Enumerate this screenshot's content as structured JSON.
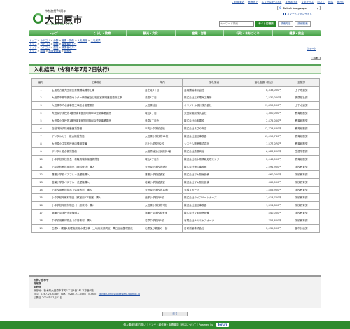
{
  "topbar": {
    "links": [
      "ご利用案内",
      "音声読上",
      "ふりがなをつける",
      "よみあげる",
      "文字サイズ",
      "小さく",
      "標準",
      "大きく"
    ]
  },
  "header": {
    "anniversary": "市制施行70周年",
    "city_name": "大田原市",
    "city_romaji": "OHTAWARA CITY",
    "lang_select": "Select Language",
    "phone_link": "スマートフォンサイト",
    "search_placeholder": "キーワード検索",
    "search_button": "サイト内検索",
    "howto_button": "検索方法",
    "advanced_button": "詳細検索"
  },
  "gnav": [
    "トップ",
    "くらし・教育",
    "観光・文化",
    "産業・労働",
    "行政・まちづくり",
    "健康・安全"
  ],
  "breadcrumbs": [
    [
      "トップ",
      "カテゴリ",
      "分野",
      "産業・労働",
      "入札情報",
      "入札結果"
    ],
    [
      "トップ",
      "カテゴリ",
      "組織",
      "事業者の方へ"
    ],
    [
      "トップ",
      "カテゴリ",
      "属性",
      "事業者の方へ"
    ],
    [
      "トップ",
      "組織",
      "検査管理課",
      "財務課"
    ]
  ],
  "tweet": "ツイート",
  "print": "印刷",
  "page_title": "入札結果（令和6年7月2日執行）",
  "table": {
    "headers": [
      "番号",
      "工事等名",
      "場所",
      "落札業者",
      "落札金額（税込）",
      "主管課"
    ],
    "rows": [
      [
        "1",
        "主要地方道大田原氏家線舗装補修工事",
        "富士見3丁目",
        "富岡舗装株式会社",
        "8,338,000円",
        "上下水道課"
      ],
      [
        "2",
        "大田原市職場健康センター研修室及び相談室照明器具更新工事",
        "浅香3丁目",
        "株式会社三和電気工業所",
        "2,530,000円",
        "健康福祉課"
      ],
      [
        "3",
        "大田原市内水道事業工事総合管理委託",
        "大田原地区",
        "オリジナル設計株式会社",
        "29,850,000円",
        "上下水道課"
      ],
      [
        "4",
        "大田原小学校外1箇所体育館照明等LED更新事業委託",
        "城山1丁目",
        "大田原電設株式会社",
        "3,300,000円",
        "教育総務課"
      ],
      [
        "5",
        "大田原小学校外1箇所体育館照明等LED更新事業委託",
        "美原1丁目外",
        "株式会社山本電設",
        "2,475,000円",
        "教育総務課"
      ],
      [
        "6",
        "自動体外式除細動器賃貸借",
        "市内小中学校全校",
        "株式会社まさや商店",
        "12,723,460円",
        "教育総務課"
      ],
      [
        "7",
        "デジタルカラー複合機賃貸借",
        "大田原小学校外11校",
        "株式会社渡辺事務器",
        "13,010,780円",
        "教育総務課"
      ],
      [
        "8",
        "大田原小中学校校地内情報整備",
        "石上小学校外2校",
        "システム興産株式会社",
        "1,577,070円",
        "教育総務課"
      ],
      [
        "9",
        "デジタル複合機賃貸借",
        "大田原地区公民館外4館",
        "株式会社斎藤商社",
        "6,988,600円",
        "生涯学習課"
      ],
      [
        "10",
        "小中学校学校校長・教職員端末機器賃貸借",
        "城山1丁目外",
        "株式会社栃木県情報処理センター",
        "2,046,000円",
        "教育総務課"
      ],
      [
        "11",
        "小中学校教材用物品（理科教材）購入",
        "大田原小学校外5校",
        "株式会社渡辺事務器",
        "2,591,900円",
        "学校教育課"
      ],
      [
        "12",
        "藩藩小学校バスフル－洗濯機購入",
        "藩藩小学校給食室",
        "株式会社マキ厨房設備",
        "660,000円",
        "学校教育課"
      ],
      [
        "13",
        "若葉小学校バスフル－洗濯機購入",
        "若葉小学校給食室",
        "株式会社マキ厨房設備",
        "660,000円",
        "学校教育課"
      ],
      [
        "14",
        "小学校用教材物品（体育教材）購入",
        "大田原小学校外10校",
        "大橋スポーツ",
        "1,406,900円",
        "学校教育課"
      ],
      [
        "15",
        "小中学校用教材物品（教室用ICT機器）購入",
        "西那小学校外6校",
        "株式会社ライフパートナーズ",
        "1,613,700円",
        "学校教育課"
      ],
      [
        "16",
        "小中学校用教材物品（一般教材）購入",
        "大田原小学校外7校",
        "株式会社渡辺事務器",
        "1,394,800円",
        "学校教育課"
      ],
      [
        "17",
        "湯津上中学校洗濯機購入",
        "湯津上中学校給食室",
        "株式会社マキ厨房設備",
        "440,000円",
        "学校教育課"
      ],
      [
        "18",
        "中学校用教材物品（体育教材）購入",
        "若草中学校外5校",
        "有限会社ナルミヤスポーツ",
        "754,600円",
        "学校教育課"
      ],
      [
        "19",
        "石黒1・親園1処理施設用水槽工事（土地改良共同区）草丘区画整理委託",
        "石黒及び親園の一部",
        "日研測量株式会社",
        "2,035,000円",
        "都市計画課"
      ]
    ]
  },
  "contact": {
    "heading": "お問い合わせ",
    "dept": "財政課",
    "section": "契約係",
    "address": "所在地：栃木県大田原市本町1丁目4番1号 本庁舎4階",
    "tel": "TEL：0287-23-8389　FAX：0287-23-8586　E-Mail：",
    "email": "keiyaku@city.ohtawara.tochigi.jp",
    "published": "公開日 2024年07月03日"
  },
  "back_button": "戻る",
  "footer": {
    "links": "｜個人情報の取り扱い｜リンク・著作権・免責事項｜RSSについて｜Powered by",
    "brand": "Joruri"
  },
  "colors": {
    "brand_green": "#2e8b2e",
    "nav_green": "#5aa55a",
    "link_blue": "#1a4aa0"
  }
}
